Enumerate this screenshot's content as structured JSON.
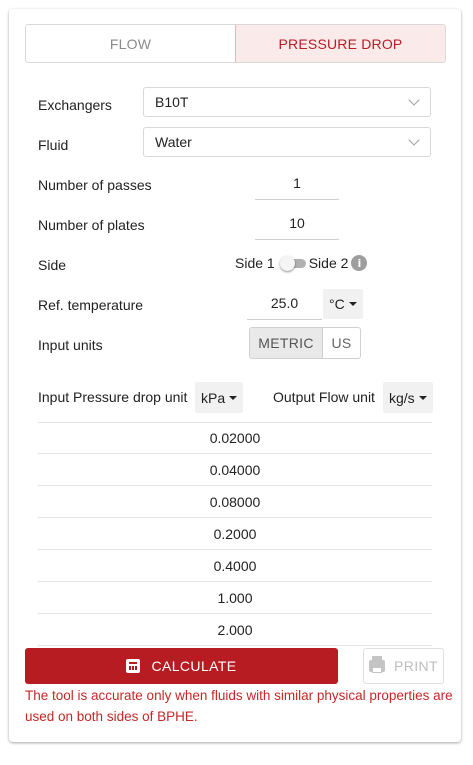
{
  "tabs": [
    {
      "label": "FLOW",
      "active": false
    },
    {
      "label": "PRESSURE DROP",
      "active": true
    }
  ],
  "form": {
    "exchangers": {
      "label": "Exchangers",
      "value": "B10T"
    },
    "fluid": {
      "label": "Fluid",
      "value": "Water"
    },
    "passes": {
      "label": "Number of passes",
      "value": "1"
    },
    "plates": {
      "label": "Number of plates",
      "value": "10"
    },
    "side": {
      "label": "Side",
      "option1": "Side 1",
      "option2": "Side 2",
      "selected": "Side 1",
      "info_icon": "info-icon"
    },
    "ref_temp": {
      "label": "Ref. temperature",
      "value": "25.0",
      "unit": "°C"
    },
    "input_units": {
      "label": "Input units",
      "options": [
        "METRIC",
        "US"
      ],
      "selected": "METRIC"
    }
  },
  "table": {
    "pressure_label": "Input Pressure drop unit",
    "pressure_unit": "kPa",
    "flow_label": "Output Flow unit",
    "flow_unit": "kg/s",
    "rows": [
      "0.02000",
      "0.04000",
      "0.08000",
      "0.2000",
      "0.4000",
      "1.000",
      "2.000"
    ]
  },
  "actions": {
    "calculate": "CALCULATE",
    "print": "PRINT"
  },
  "warning": "The tool is accurate only when fluids with similar physical properties are used on both sides of BPHE.",
  "colors": {
    "accent": "#b71c23",
    "warning": "#c62828"
  }
}
